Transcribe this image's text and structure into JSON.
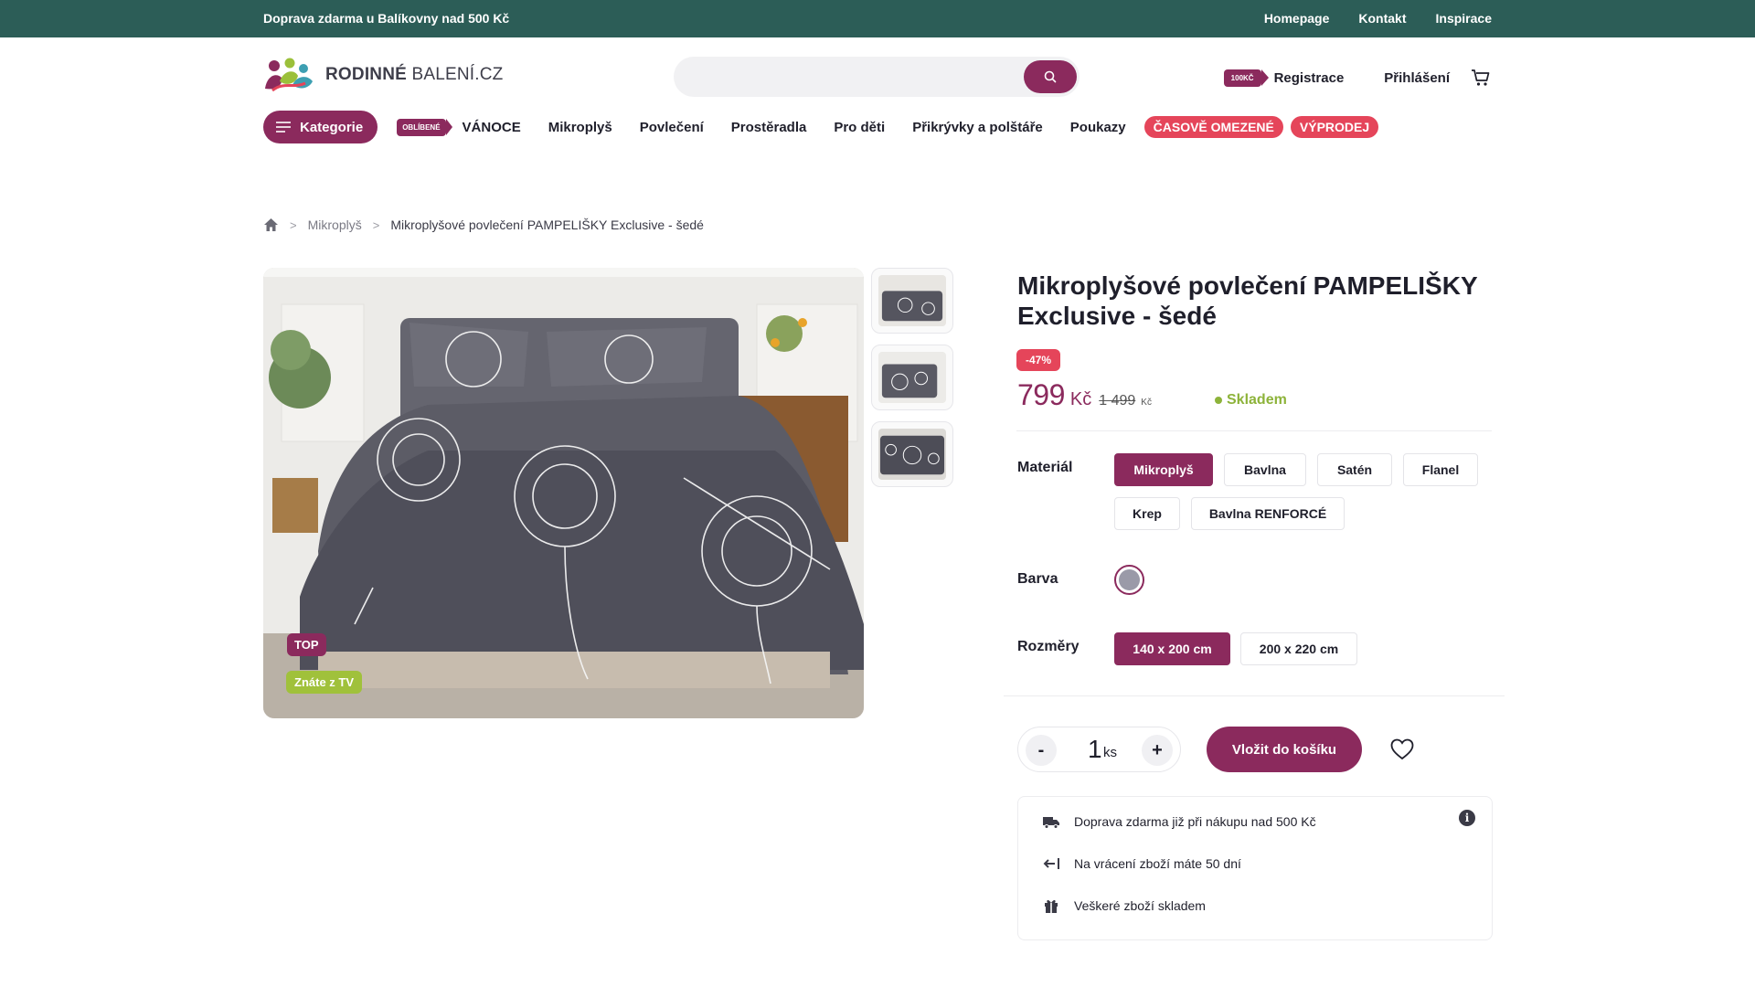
{
  "topbar": {
    "promo": "Doprava zdarma u Balíkovny nad 500 Kč",
    "links": [
      "Homepage",
      "Kontakt",
      "Inspirace"
    ]
  },
  "logo": {
    "bold": "RODINNÉ",
    "rest": " BALENÍ.CZ"
  },
  "search": {
    "placeholder": ""
  },
  "user": {
    "bonus_badge": "100KČ",
    "register": "Registrace",
    "login": "Přihlášení"
  },
  "nav": {
    "categories": "Kategorie",
    "fav_badge": "OBLÍBENÉ",
    "items": [
      "VÁNOCE",
      "Mikroplyš",
      "Povlečení",
      "Prostěradla",
      "Pro děti",
      "Přikrývky a polštáře",
      "Poukazy"
    ],
    "promo_pills": [
      "ČASOVĚ OMEZENÉ",
      "VÝPRODEJ"
    ]
  },
  "breadcrumb": {
    "sep": ">",
    "category": "Mikroplyš",
    "current": "Mikroplyšové povlečení PAMPELIŠKY Exclusive - šedé"
  },
  "gallery": {
    "tag_top": "TOP",
    "tag_tv": "Znáte z TV"
  },
  "product": {
    "title": "Mikroplyšové povlečení PAMPELIŠKY Exclusive - šedé",
    "discount": "-47%",
    "price": "799",
    "currency": "Kč",
    "old_price": "1 499",
    "old_currency": "Kč",
    "stock": "Skladem",
    "colors": {
      "brand": "#8b2a5d",
      "sale": "#e5455a",
      "stock": "#8db33a",
      "topbar": "#2c5d57",
      "fabric": "#9a9aa8"
    }
  },
  "options": {
    "material_label": "Materiál",
    "materials": [
      "Mikroplyš",
      "Bavlna",
      "Satén",
      "Flanel",
      "Krep",
      "Bavlna RENFORCÉ"
    ],
    "selected_material": "Mikroplyš",
    "color_label": "Barva",
    "size_label": "Rozměry",
    "sizes": [
      "140 x 200 cm",
      "200 x 220 cm"
    ],
    "selected_size": "140 x 200 cm"
  },
  "cart": {
    "minus": "-",
    "plus": "+",
    "qty": "1",
    "unit": "ks",
    "add_label": "Vložit do košíku"
  },
  "info": {
    "rows": [
      "Doprava zdarma již při nákupu nad 500 Kč",
      "Na vrácení zboží máte 50 dní",
      "Veškeré zboží skladem"
    ],
    "info_icon": "i"
  }
}
